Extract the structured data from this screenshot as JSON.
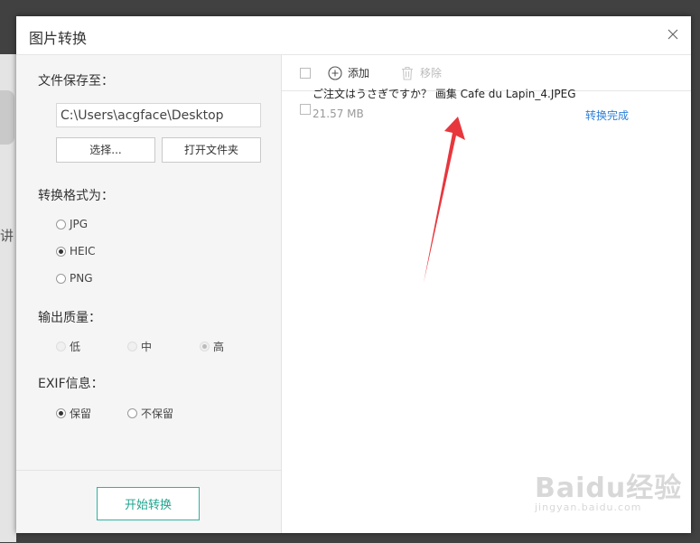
{
  "dialog": {
    "title": "图片转换"
  },
  "left": {
    "save_label": "文件保存至：",
    "save_path": "C:\\Users\\acgface\\Desktop",
    "choose_button": "选择...",
    "open_folder_button": "打开文件夹",
    "format_label": "转换格式为：",
    "formats": [
      {
        "label": "JPG",
        "selected": false
      },
      {
        "label": "HEIC",
        "selected": true
      },
      {
        "label": "PNG",
        "selected": false
      }
    ],
    "quality_label": "输出质量：",
    "qualities": [
      {
        "label": "低",
        "selected": false
      },
      {
        "label": "中",
        "selected": false
      },
      {
        "label": "高",
        "selected": true
      }
    ],
    "exif_label": "EXIF信息：",
    "exif_options": [
      {
        "label": "保留",
        "selected": true
      },
      {
        "label": "不保留",
        "selected": false
      }
    ],
    "start_button": "开始转换"
  },
  "toolbar": {
    "add_label": "添加",
    "remove_label": "移除"
  },
  "files": [
    {
      "name": "ご注文はうさぎですか？ 画集 Cafe du Lapin_4.JPEG",
      "size": "21.57 MB",
      "status": "转换完成"
    }
  ],
  "watermark": {
    "text": "Baidu经验",
    "url": "jingyan.baidu.com"
  },
  "colors": {
    "accent": "#20a58f",
    "status": "#2d7fd8",
    "arrow": "#e8363d"
  }
}
